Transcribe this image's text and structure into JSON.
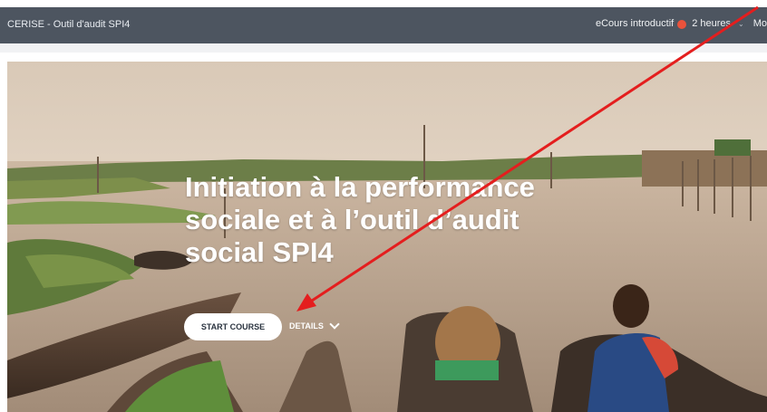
{
  "header": {
    "title": "CERISE - Outil d'audit SPI4",
    "course_type": "eCours introductif",
    "duration": "2 heures",
    "more_label": "Mo"
  },
  "hero": {
    "title_lines": [
      "Initiation à la performance",
      "sociale et à l’outil d’audit",
      "social SPI4"
    ],
    "start_button": "START COURSE",
    "details_label": "DETAILS"
  },
  "colors": {
    "topbar": "#4d5560",
    "button_bg": "#ffffff",
    "annotation": "#e41e1e"
  }
}
